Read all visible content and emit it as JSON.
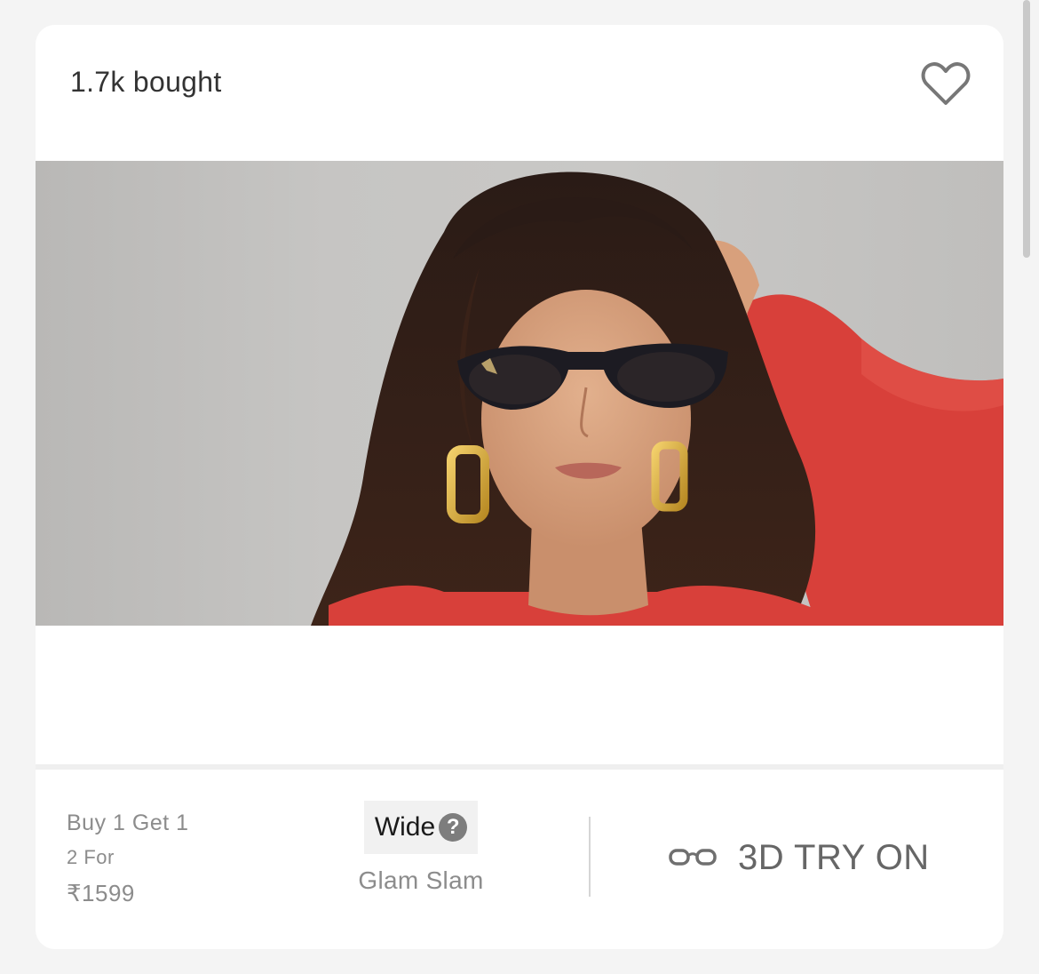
{
  "product": {
    "bought_count": "1.7k bought",
    "image_alt": "Model wearing dark cat-eye sunglasses",
    "offer_line1": "Buy 1 Get 1",
    "offer_line2": "2 For",
    "offer_price": "₹1599",
    "frame_width": "Wide",
    "help_symbol": "?",
    "collection": "Glam Slam",
    "tryon_label": "3D TRY ON"
  },
  "icons": {
    "wishlist": "heart-outline-icon",
    "help": "question-circle-icon",
    "tryon": "glasses-icon"
  },
  "colors": {
    "card_bg": "#ffffff",
    "page_bg": "#f4f4f4",
    "muted_text": "#8c8c8c",
    "dress_red": "#d8403a"
  }
}
